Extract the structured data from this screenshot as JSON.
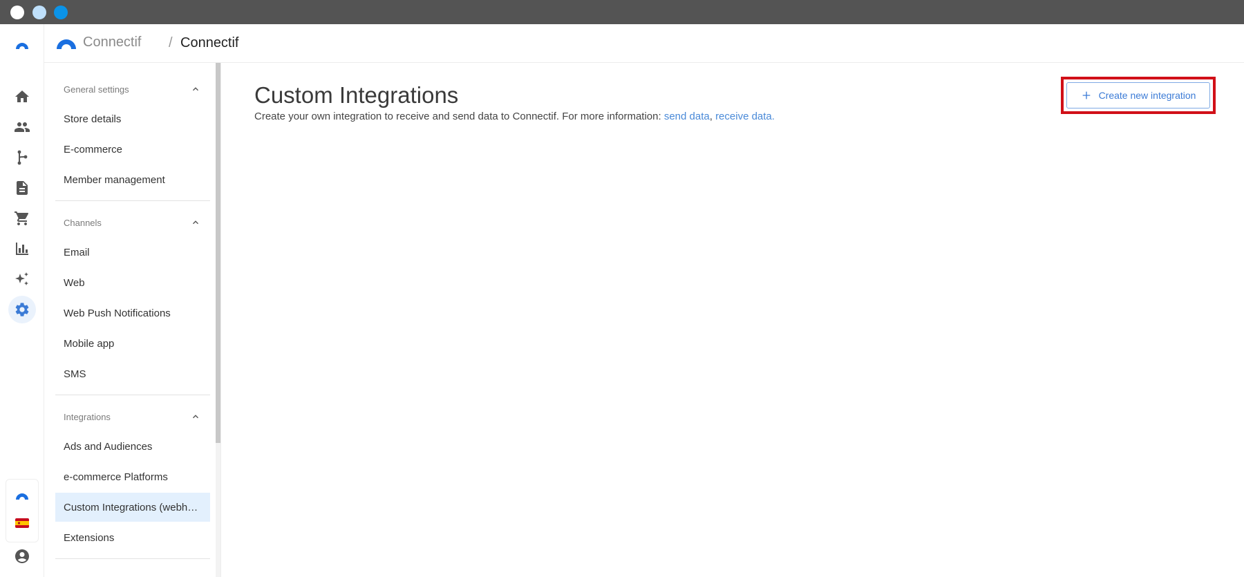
{
  "header": {
    "brand_name": "Connectif",
    "breadcrumb_separator": "/",
    "breadcrumb_current": "Connectif"
  },
  "rail": {
    "items": [
      {
        "icon": "home-icon"
      },
      {
        "icon": "contacts-icon"
      },
      {
        "icon": "workflow-icon"
      },
      {
        "icon": "document-icon"
      },
      {
        "icon": "cart-icon"
      },
      {
        "icon": "chart-icon"
      },
      {
        "icon": "sparkle-icon"
      },
      {
        "icon": "settings-icon",
        "active": true
      }
    ],
    "bottom": [
      "connectif-logo-icon",
      "spain-flag-icon",
      "account-icon"
    ]
  },
  "sidebar": {
    "sections": [
      {
        "title": "General settings",
        "items": [
          "Store details",
          "E-commerce",
          "Member management"
        ]
      },
      {
        "title": "Channels",
        "items": [
          "Email",
          "Web",
          "Web Push Notifications",
          "Mobile app",
          "SMS"
        ]
      },
      {
        "title": "Integrations",
        "items": [
          "Ads and Audiences",
          "e-commerce Platforms",
          "Custom Integrations (webhooks)",
          "Extensions"
        ]
      }
    ],
    "active_item": "Custom Integrations (webhooks)"
  },
  "main": {
    "title": "Custom Integrations",
    "description_prefix": "Create your own integration to receive and send data to Connectif. For more information: ",
    "link_send": "send data",
    "link_separator": ", ",
    "link_receive": "receive data.",
    "create_button": "Create new integration"
  },
  "colors": {
    "accent": "#3b7bd6",
    "highlight_border": "#d11018",
    "active_bg": "#e3f0fd"
  }
}
